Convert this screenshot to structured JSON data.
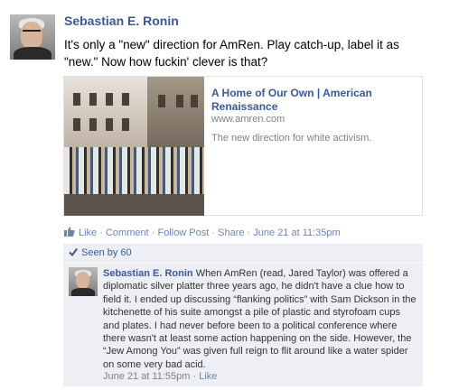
{
  "post": {
    "author": "Sebastian E. Ronin",
    "message": "It's only a \"new\" direction for AmRen. Play catch-up, label it as \"new.\" Now how fuckin' clever is that?"
  },
  "link": {
    "title": "A Home of Our Own | American Renaissance",
    "domain": "www.amren.com",
    "description": "The new direction for white activism."
  },
  "actions": {
    "like": "Like",
    "comment": "Comment",
    "follow": "Follow Post",
    "share": "Share",
    "timestamp": "June 21 at 11:35pm",
    "separator": "·"
  },
  "seen": {
    "label": "Seen by 60"
  },
  "comment": {
    "author": "Sebastian E. Ronin",
    "text": "When AmRen (read, Jared Taylor) was offered a diplomatic silver platter three years ago, he didn't have a clue how to field it. I ended up discussing “flanking politics” with Sam Dickson in the kitchenette of his suite amongst a pile of plastic and styrofoam cups and plates. I had never before been to a political conference where there wasn't at least some action happening on the side. However, the “Jew Among You” was given full reign to flit around like a water spider on some very bad acid.",
    "timestamp": "June 21 at 11:55pm",
    "like": "Like",
    "separator": "·"
  },
  "colors": {
    "link_blue": "#3b5998",
    "action_blue": "#6d84b4",
    "meta_gray": "#808080",
    "comment_bg": "#edeff4"
  },
  "icons": {
    "post_avatar": "user-avatar",
    "like": "thumbs-up-icon",
    "seen": "checkmark-icon"
  }
}
